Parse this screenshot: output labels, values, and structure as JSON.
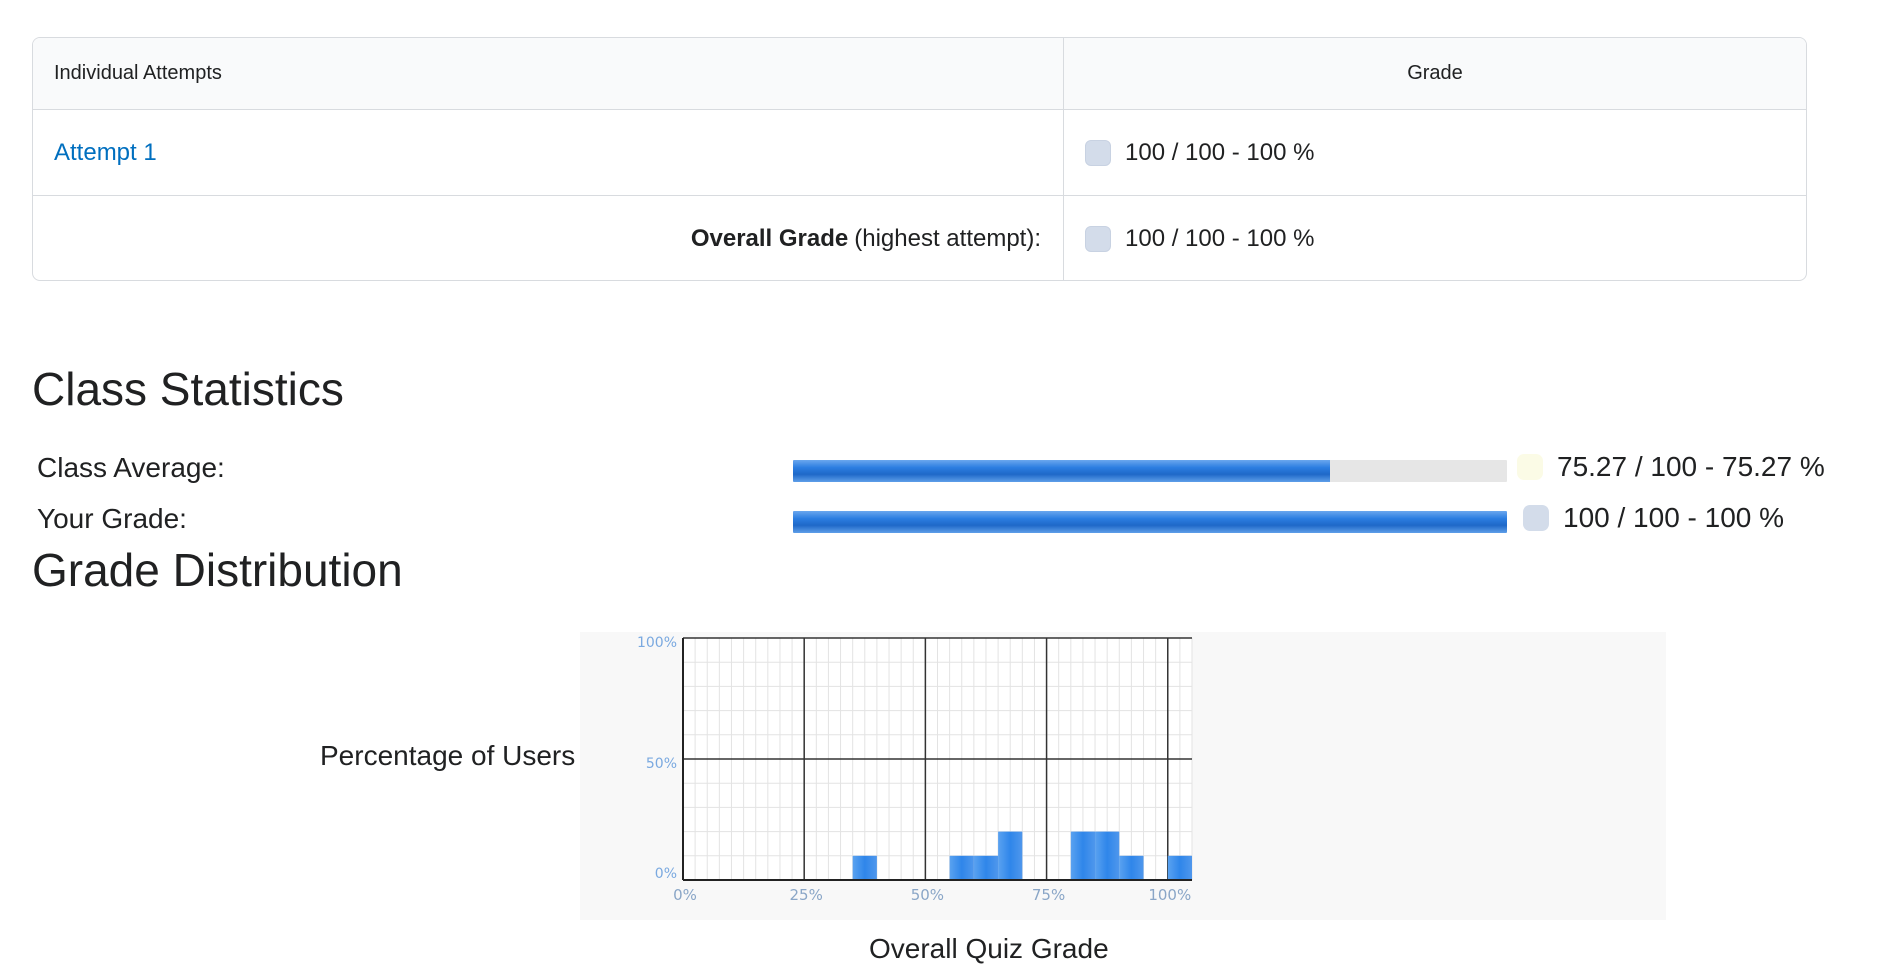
{
  "attempts_table": {
    "header": {
      "col1": "Individual Attempts",
      "col2": "Grade"
    },
    "rows": [
      {
        "label": "Attempt 1",
        "grade": "100 / 100 - 100 %"
      }
    ],
    "overall": {
      "label_bold": "Overall Grade",
      "label_rest": "(highest attempt):",
      "grade": "100 / 100 - 100 %"
    }
  },
  "class_statistics": {
    "heading": "Class Statistics",
    "class_average": {
      "label": "Class Average:",
      "value_text": "75.27 / 100 - 75.27 %",
      "fraction": 0.7527,
      "swatch_color": "#fbfbe6"
    },
    "your_grade": {
      "label": "Your Grade:",
      "value_text": "100 / 100 - 100 %",
      "fraction": 1.0,
      "swatch_color": "#d3dcea"
    }
  },
  "grade_distribution": {
    "heading": "Grade Distribution",
    "y_title": "Percentage of Users",
    "x_title": "Overall Quiz Grade"
  },
  "chart_data": {
    "type": "bar",
    "xlabel": "Overall Quiz Grade",
    "ylabel": "Percentage of Users",
    "x_ticks": [
      "0%",
      "25%",
      "50%",
      "75%",
      "100%"
    ],
    "y_ticks": [
      "0%",
      "50%",
      "100%"
    ],
    "ylim": [
      0,
      100
    ],
    "xlim": [
      0,
      105
    ],
    "bin_width": 5,
    "bins": [
      0,
      5,
      10,
      15,
      20,
      25,
      30,
      35,
      40,
      45,
      50,
      55,
      60,
      65,
      70,
      75,
      80,
      85,
      90,
      95,
      100
    ],
    "values": [
      0,
      0,
      0,
      0,
      0,
      0,
      0,
      10,
      0,
      0,
      0,
      10,
      10,
      20,
      0,
      0,
      20,
      20,
      10,
      0,
      10
    ],
    "grid": true,
    "bar_color": "#2f86ea"
  }
}
